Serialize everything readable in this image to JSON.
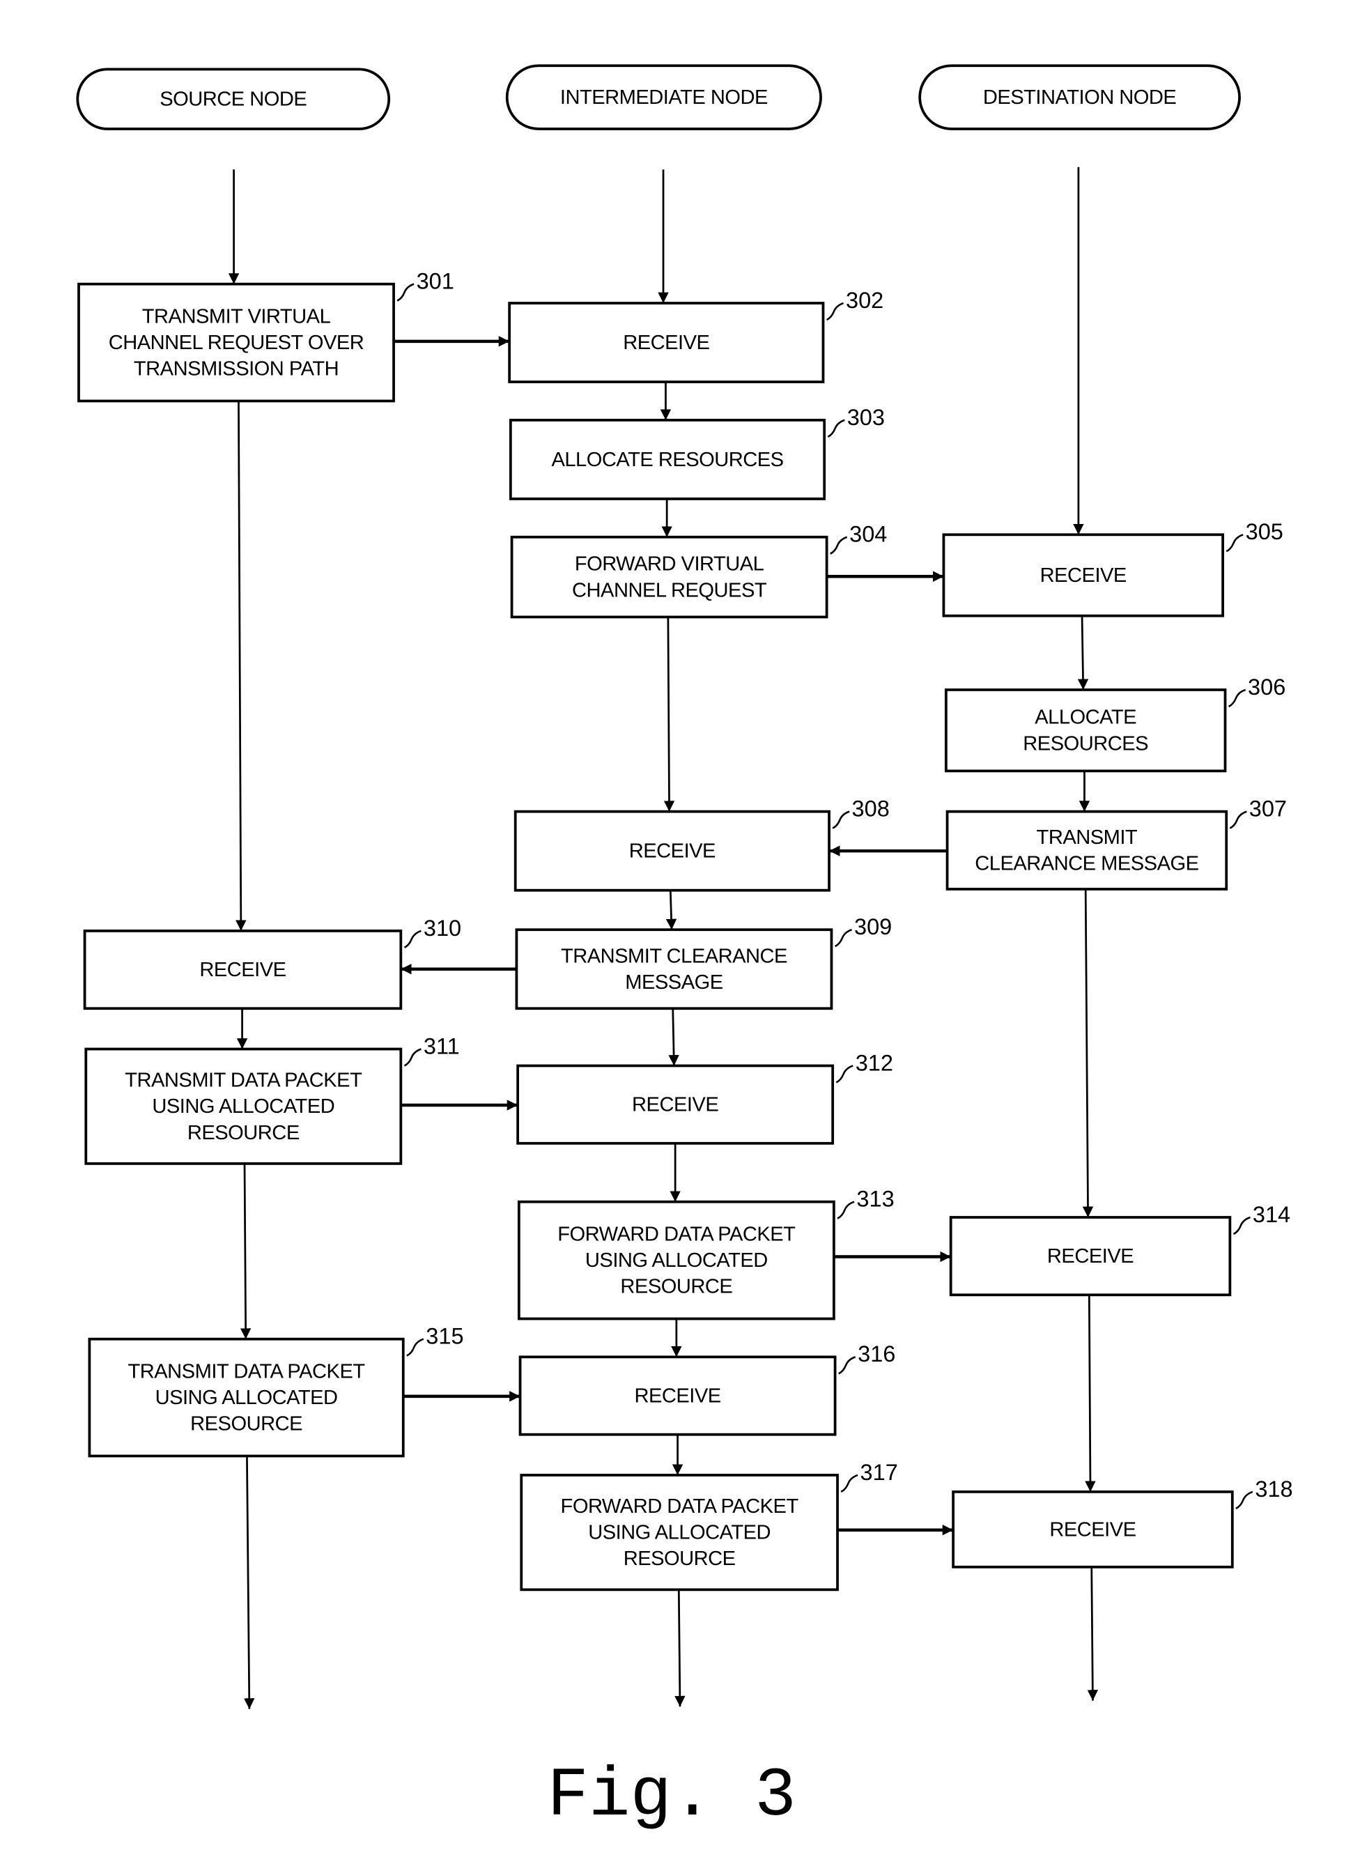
{
  "figure": {
    "caption": "Fig. 3",
    "lanes": [
      {
        "id": "source",
        "label": "SOURCE NODE"
      },
      {
        "id": "intermediate",
        "label": "INTERMEDIATE NODE"
      },
      {
        "id": "destination",
        "label": "DESTINATION NODE"
      }
    ],
    "steps": [
      {
        "ref": "301",
        "lane": "source",
        "lines": [
          "TRANSMIT VIRTUAL",
          "CHANNEL REQUEST OVER",
          "TRANSMISSION PATH"
        ]
      },
      {
        "ref": "302",
        "lane": "intermediate",
        "lines": [
          "RECEIVE"
        ]
      },
      {
        "ref": "303",
        "lane": "intermediate",
        "lines": [
          "ALLOCATE RESOURCES"
        ]
      },
      {
        "ref": "304",
        "lane": "intermediate",
        "lines": [
          "FORWARD VIRTUAL",
          "CHANNEL REQUEST"
        ]
      },
      {
        "ref": "305",
        "lane": "destination",
        "lines": [
          "RECEIVE"
        ]
      },
      {
        "ref": "306",
        "lane": "destination",
        "lines": [
          "ALLOCATE",
          "RESOURCES"
        ]
      },
      {
        "ref": "307",
        "lane": "destination",
        "lines": [
          "TRANSMIT",
          "CLEARANCE MESSAGE"
        ]
      },
      {
        "ref": "308",
        "lane": "intermediate",
        "lines": [
          "RECEIVE"
        ]
      },
      {
        "ref": "309",
        "lane": "intermediate",
        "lines": [
          "TRANSMIT CLEARANCE",
          "MESSAGE"
        ]
      },
      {
        "ref": "310",
        "lane": "source",
        "lines": [
          "RECEIVE"
        ]
      },
      {
        "ref": "311",
        "lane": "source",
        "lines": [
          "TRANSMIT DATA PACKET",
          "USING ALLOCATED",
          "RESOURCE"
        ]
      },
      {
        "ref": "312",
        "lane": "intermediate",
        "lines": [
          "RECEIVE"
        ]
      },
      {
        "ref": "313",
        "lane": "intermediate",
        "lines": [
          "FORWARD DATA PACKET",
          "USING ALLOCATED",
          "RESOURCE"
        ]
      },
      {
        "ref": "314",
        "lane": "destination",
        "lines": [
          "RECEIVE"
        ]
      },
      {
        "ref": "315",
        "lane": "source",
        "lines": [
          "TRANSMIT DATA PACKET",
          "USING ALLOCATED",
          "RESOURCE"
        ]
      },
      {
        "ref": "316",
        "lane": "intermediate",
        "lines": [
          "RECEIVE"
        ]
      },
      {
        "ref": "317",
        "lane": "intermediate",
        "lines": [
          "FORWARD DATA PACKET",
          "USING ALLOCATED",
          "RESOURCE"
        ]
      },
      {
        "ref": "318",
        "lane": "destination",
        "lines": [
          "RECEIVE"
        ]
      }
    ],
    "connections": [
      {
        "from": "source-start",
        "to": "301"
      },
      {
        "from": "intermediate-start",
        "to": "302"
      },
      {
        "from": "destination-start",
        "to": "305"
      },
      {
        "from": "301",
        "to": "302"
      },
      {
        "from": "301",
        "to": "310"
      },
      {
        "from": "302",
        "to": "303"
      },
      {
        "from": "303",
        "to": "304"
      },
      {
        "from": "304",
        "to": "305"
      },
      {
        "from": "304",
        "to": "308"
      },
      {
        "from": "305",
        "to": "306"
      },
      {
        "from": "306",
        "to": "307"
      },
      {
        "from": "307",
        "to": "308"
      },
      {
        "from": "307",
        "to": "314"
      },
      {
        "from": "308",
        "to": "309"
      },
      {
        "from": "309",
        "to": "310"
      },
      {
        "from": "309",
        "to": "312"
      },
      {
        "from": "310",
        "to": "311"
      },
      {
        "from": "311",
        "to": "312"
      },
      {
        "from": "311",
        "to": "315"
      },
      {
        "from": "312",
        "to": "313"
      },
      {
        "from": "313",
        "to": "314"
      },
      {
        "from": "313",
        "to": "316"
      },
      {
        "from": "314",
        "to": "318"
      },
      {
        "from": "315",
        "to": "316"
      },
      {
        "from": "315",
        "to": "source-end"
      },
      {
        "from": "316",
        "to": "317"
      },
      {
        "from": "317",
        "to": "318"
      },
      {
        "from": "317",
        "to": "intermediate-end"
      },
      {
        "from": "318",
        "to": "destination-end"
      }
    ]
  }
}
